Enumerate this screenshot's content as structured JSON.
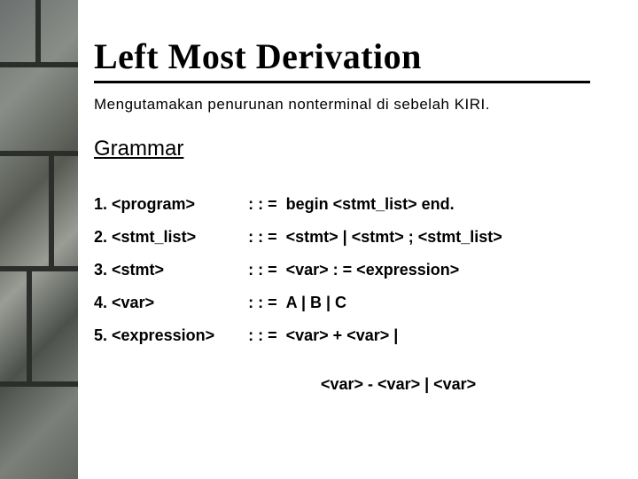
{
  "title": "Left Most Derivation",
  "subtitle": "Mengutamakan  penurunan  nonterminal  di  sebelah  KIRI.",
  "section": "Grammar",
  "op": ": : =",
  "rules": [
    {
      "num": "1.",
      "lhs": "<program>",
      "rhs": " begin <stmt_list> end."
    },
    {
      "num": "2.",
      "lhs": "<stmt_list>",
      "rhs": " <stmt> | <stmt> ; <stmt_list>"
    },
    {
      "num": "3.",
      "lhs": "<stmt>",
      "rhs": " <var> : = <expression>"
    },
    {
      "num": "4.",
      "lhs": "<var>",
      "rhs": " A | B | C"
    },
    {
      "num": "5.",
      "lhs": "<expression>",
      "rhs": " <var> + <var> |"
    }
  ],
  "continuation": "<var> - <var> | <var>"
}
